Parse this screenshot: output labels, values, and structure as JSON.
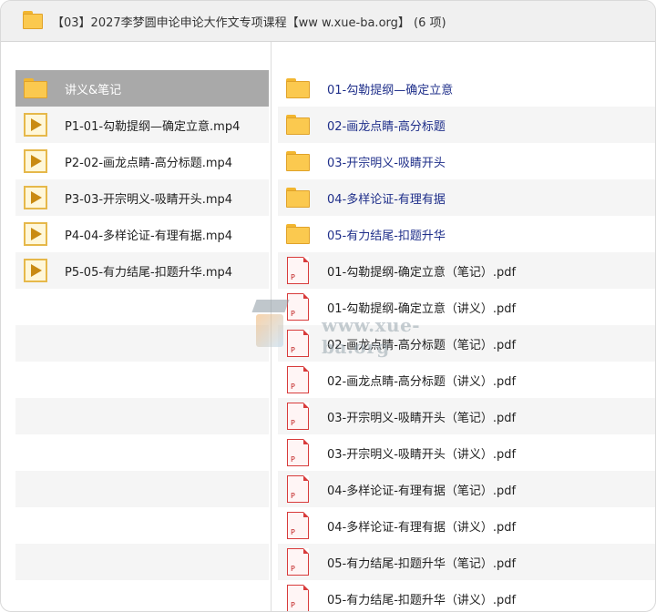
{
  "window": {
    "title": "【03】2027李梦圆申论申论大作文专项课程【ww w.xue-ba.org】 (6 项)"
  },
  "left_list": [
    {
      "label": "讲义&笔记",
      "icon": "folder-icon",
      "selected": true
    },
    {
      "label": "P1-01-勾勒提纲—确定立意.mp4",
      "icon": "video-icon"
    },
    {
      "label": "P2-02-画龙点睛-高分标题.mp4",
      "icon": "video-icon"
    },
    {
      "label": "P3-03-开宗明义-吸睛开头.mp4",
      "icon": "video-icon"
    },
    {
      "label": "P4-04-多样论证-有理有据.mp4",
      "icon": "video-icon"
    },
    {
      "label": "P5-05-有力结尾-扣题升华.mp4",
      "icon": "video-icon"
    }
  ],
  "right_list": [
    {
      "label": "01-勾勒提纲—确定立意",
      "icon": "folder-icon"
    },
    {
      "label": "02-画龙点睛-高分标题",
      "icon": "folder-icon"
    },
    {
      "label": "03-开宗明义-吸睛开头",
      "icon": "folder-icon"
    },
    {
      "label": "04-多样论证-有理有据",
      "icon": "folder-icon"
    },
    {
      "label": "05-有力结尾-扣题升华",
      "icon": "folder-icon"
    },
    {
      "label": "01-勾勒提纲-确定立意（笔记）.pdf",
      "icon": "pdf-icon"
    },
    {
      "label": "01-勾勒提纲-确定立意（讲义）.pdf",
      "icon": "pdf-icon"
    },
    {
      "label": "02-画龙点睛-高分标题（笔记）.pdf",
      "icon": "pdf-icon"
    },
    {
      "label": "02-画龙点睛-高分标题（讲义）.pdf",
      "icon": "pdf-icon"
    },
    {
      "label": "03-开宗明义-吸睛开头（笔记）.pdf",
      "icon": "pdf-icon"
    },
    {
      "label": "03-开宗明义-吸睛开头（讲义）.pdf",
      "icon": "pdf-icon"
    },
    {
      "label": "04-多样论证-有理有据（笔记）.pdf",
      "icon": "pdf-icon"
    },
    {
      "label": "04-多样论证-有理有据（讲义）.pdf",
      "icon": "pdf-icon"
    },
    {
      "label": "05-有力结尾-扣题升华（笔记）.pdf",
      "icon": "pdf-icon"
    },
    {
      "label": "05-有力结尾-扣题升华（讲义）.pdf",
      "icon": "pdf-icon"
    }
  ],
  "watermark": {
    "text": "www.xue-ba.org"
  },
  "colors": {
    "folder": "#fbc94f",
    "selected_row": "#a9a9a9",
    "folder_link": "#1f2f8a",
    "pdf": "#d83b3b"
  }
}
